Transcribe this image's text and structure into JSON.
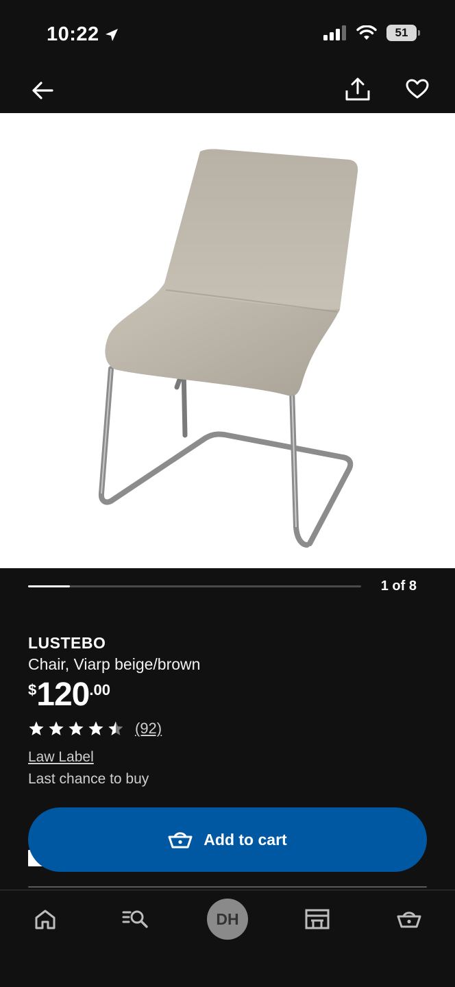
{
  "status_bar": {
    "time": "10:22",
    "battery": "51"
  },
  "top_nav": {
    "back_icon": "arrow-left-icon",
    "share_icon": "share-icon",
    "favorite_icon": "heart-icon"
  },
  "gallery": {
    "counter": "1 of 8",
    "progress": 0.125
  },
  "product": {
    "name": "LUSTEBO",
    "description": "Chair, Viarp beige/brown",
    "price_currency": "$",
    "price_integer": "120",
    "price_decimal": ".00",
    "rating": 4.5,
    "review_count": "(92)",
    "law_label": "Law Label",
    "availability": "Last chance to buy"
  },
  "cart_button": {
    "label": "Add to cart",
    "color": "#0058a3"
  },
  "tab_bar": {
    "items": [
      {
        "name": "home",
        "icon": "home-icon"
      },
      {
        "name": "search",
        "icon": "search-list-icon"
      },
      {
        "name": "profile",
        "avatar_text": "DH"
      },
      {
        "name": "stores",
        "icon": "store-icon"
      },
      {
        "name": "cart",
        "icon": "basket-icon"
      }
    ]
  }
}
